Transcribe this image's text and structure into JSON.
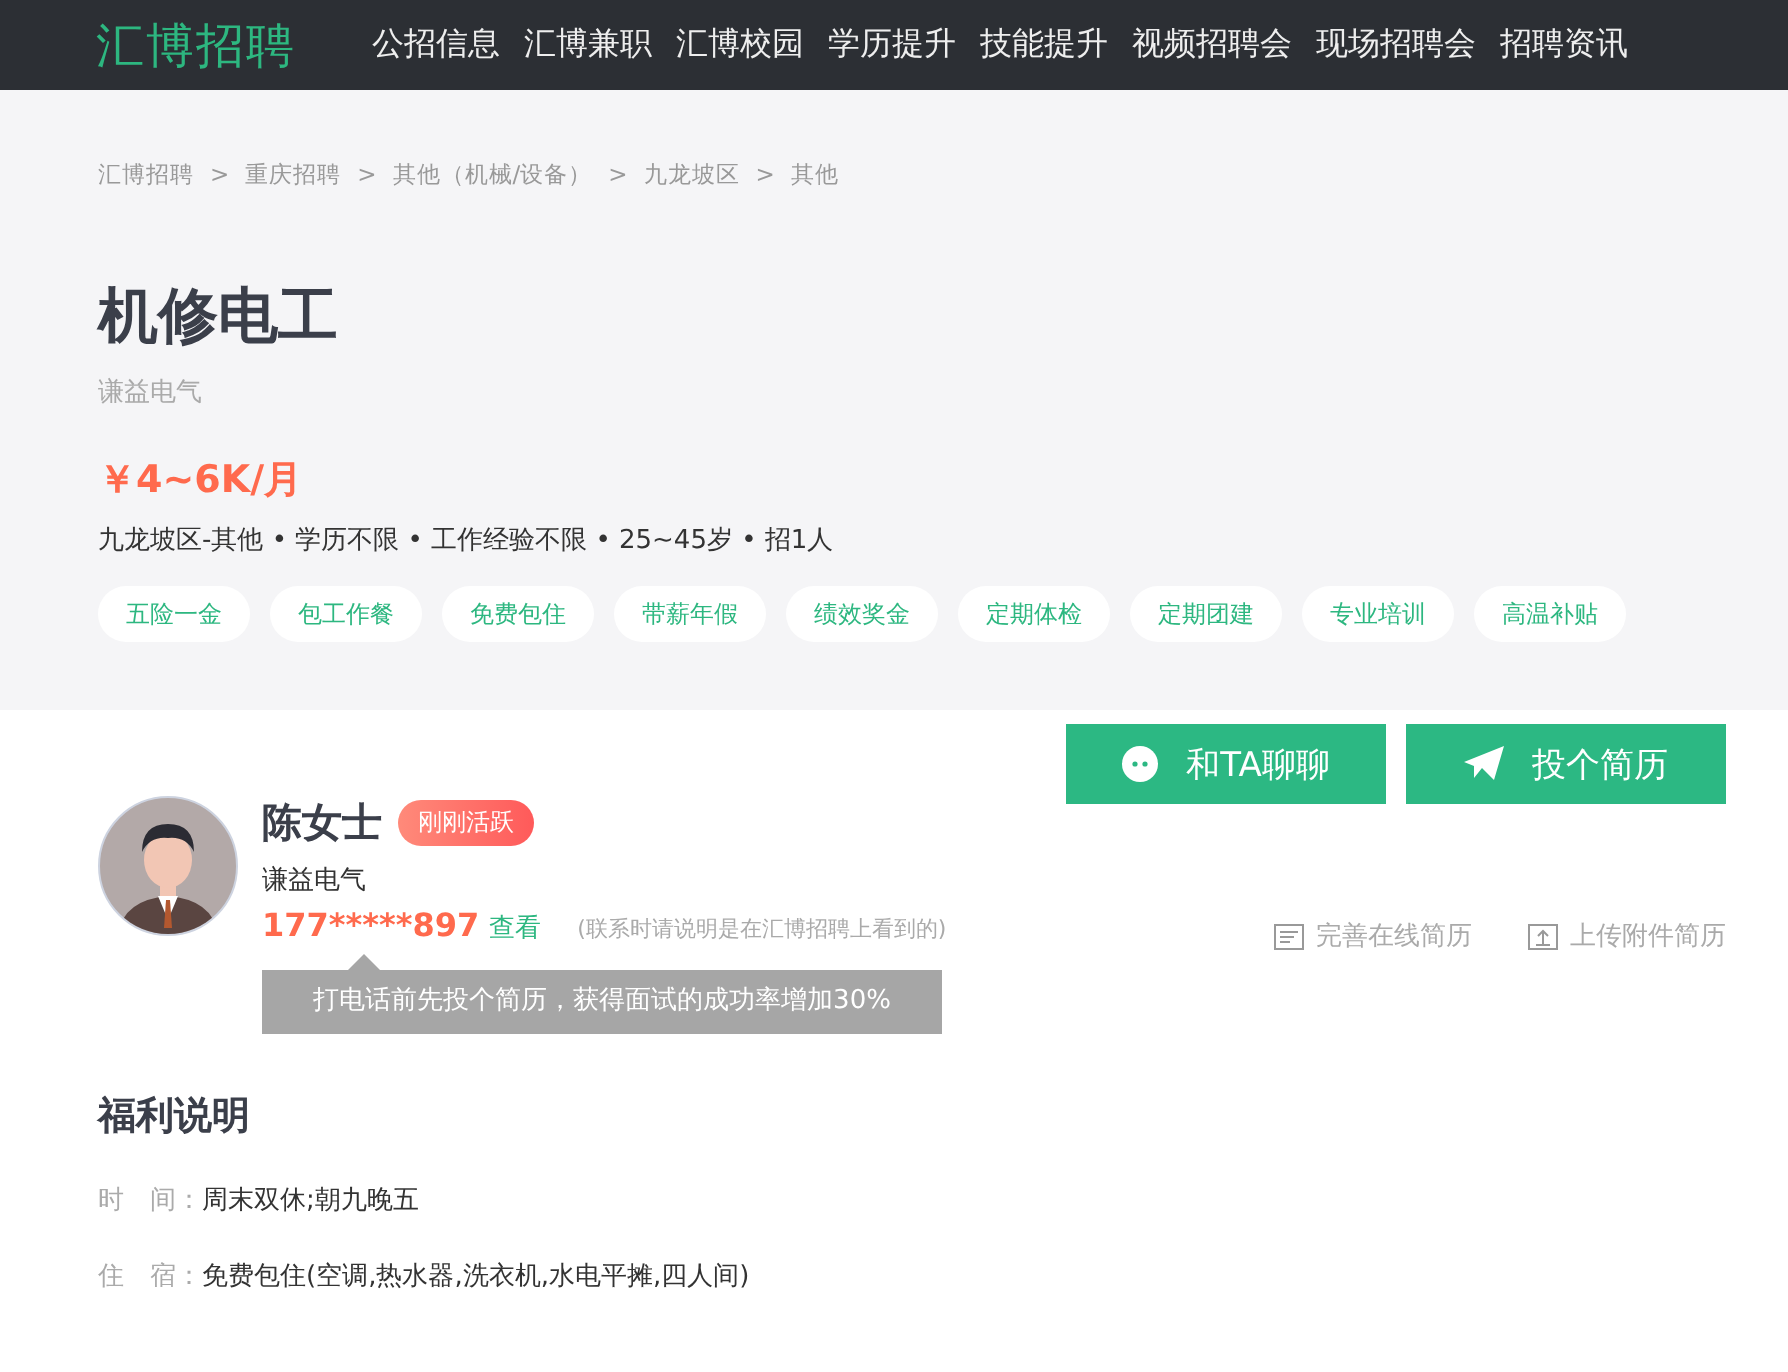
{
  "nav": {
    "logo": "汇博招聘",
    "items": [
      "公招信息",
      "汇博兼职",
      "汇博校园",
      "学历提升",
      "技能提升",
      "视频招聘会",
      "现场招聘会",
      "招聘资讯"
    ]
  },
  "breadcrumb": {
    "separator": ">",
    "items": [
      "汇博招聘",
      "重庆招聘",
      "其他（机械/设备）",
      "九龙坡区",
      "其他"
    ]
  },
  "job": {
    "title": "机修电工",
    "company": "谦益电气",
    "salary": "￥4~6K/月",
    "info": "九龙坡区-其他 • 学历不限 • 工作经验不限  • 25~45岁 • 招1人",
    "tags": [
      "五险一金",
      "包工作餐",
      "免费包住",
      "带薪年假",
      "绩效奖金",
      "定期体检",
      "定期团建",
      "专业培训",
      "高温补贴"
    ]
  },
  "contact": {
    "name": "陈女士",
    "badge": "刚刚活跃",
    "company": "谦益电气",
    "phone": "177*****897",
    "view_link": "查看",
    "note": "(联系时请说明是在汇博招聘上看到的)",
    "tooltip": "打电话前先投个简历，获得面试的成功率增加30%"
  },
  "actions": [
    {
      "kind": "chat",
      "label": "和TA聊聊"
    },
    {
      "kind": "send",
      "label": "投个简历"
    }
  ],
  "resume_links": [
    {
      "kind": "online",
      "label": "完善在线简历"
    },
    {
      "kind": "upload",
      "label": "上传附件简历"
    }
  ],
  "benefits": {
    "title": "福利说明",
    "rows": [
      {
        "label": "时　间：",
        "value": "周末双休;朝九晚五"
      },
      {
        "label": "住　宿：",
        "value": "免费包住(空调,热水器,洗衣机,水电平摊,四人间)"
      }
    ]
  }
}
